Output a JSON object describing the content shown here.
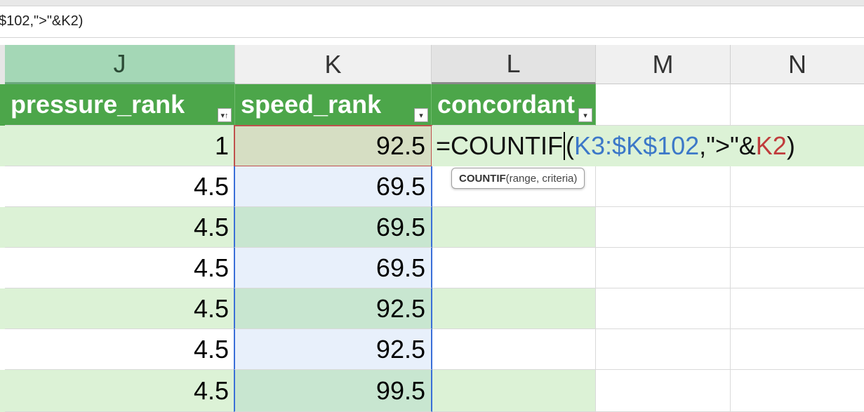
{
  "formula_bar": {
    "visible_text": "$102,\">\"&K2)"
  },
  "columns": [
    {
      "letter": "J",
      "state": "selected"
    },
    {
      "letter": "K",
      "state": "normal"
    },
    {
      "letter": "L",
      "state": "active"
    },
    {
      "letter": "M",
      "state": "normal"
    },
    {
      "letter": "N",
      "state": "normal"
    }
  ],
  "table_headers": {
    "j": "pressure_rank",
    "k": "speed_rank",
    "l": "concordant"
  },
  "filter_icons": {
    "j": "sort-ascending-filter-icon",
    "k": "filter-dropdown-icon",
    "l": "filter-dropdown-icon"
  },
  "rows": [
    {
      "pressure_rank": "1",
      "speed_rank": "92.5"
    },
    {
      "pressure_rank": "4.5",
      "speed_rank": "69.5"
    },
    {
      "pressure_rank": "4.5",
      "speed_rank": "69.5"
    },
    {
      "pressure_rank": "4.5",
      "speed_rank": "69.5"
    },
    {
      "pressure_rank": "4.5",
      "speed_rank": "92.5"
    },
    {
      "pressure_rank": "4.5",
      "speed_rank": "92.5"
    },
    {
      "pressure_rank": "4.5",
      "speed_rank": "99.5"
    }
  ],
  "editing_formula": {
    "eq_func": "=COUNTIF",
    "open_paren": "(",
    "range_ref": "K3:$K$102",
    "criteria_text": ",\">\"&",
    "criteria_ref": "K2",
    "close_paren": ")"
  },
  "tooltip": {
    "func_name": "COUNTIF",
    "args": "(range, criteria)"
  },
  "colors": {
    "table_header_green": "#4ca64a",
    "band_green": "#dcf2d6",
    "range_ref_blue": "#3c78c8",
    "criteria_ref_red": "#c03c3c"
  }
}
